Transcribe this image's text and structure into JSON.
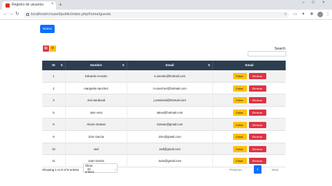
{
  "browser": {
    "tab_title": "Registro de usuarios",
    "tab_close": "×",
    "new_tab": "+",
    "url": "localhost/crousel/public/index.php/home/guests",
    "window_controls": [
      "–",
      "□",
      "×"
    ]
  },
  "page": {
    "new_button": "Nuevo",
    "search_label": "Search",
    "columns": [
      "ID",
      "Nombre",
      "Email",
      "Email"
    ],
    "rows": [
      {
        "id": "1",
        "nombre": "Eduardo Arevalo",
        "email": "e.arevalo@hotmail.com"
      },
      {
        "id": "2",
        "nombre": "margarita sanchez",
        "email": "m.sanchez@hotmail.com"
      },
      {
        "id": "3",
        "nombre": "Josi sandoval",
        "email": "j.sandoval@hotmail.com"
      },
      {
        "id": "5",
        "nombre": "alex vera",
        "email": "alexa@hotmail.com"
      },
      {
        "id": "9",
        "nombre": "Alvaro Guteas",
        "email": "Guteas@gmail.com"
      },
      {
        "id": "9",
        "nombre": "Zion Garcia",
        "email": "Zion@gmail.com"
      },
      {
        "id": "10",
        "nombre": "asd",
        "email": "asd@gmail.com"
      },
      {
        "id": "11",
        "nombre": "Juan Garcia",
        "email": "Juan@gmail.com"
      }
    ],
    "edit_label": "Editar",
    "delete_label": "Eliminar",
    "info": "Showing 1 to 8 of 8 entries",
    "length_select": [
      "Show",
      "10",
      "entries"
    ],
    "prev": "Previous",
    "page_number": "1",
    "next": "Next"
  }
}
